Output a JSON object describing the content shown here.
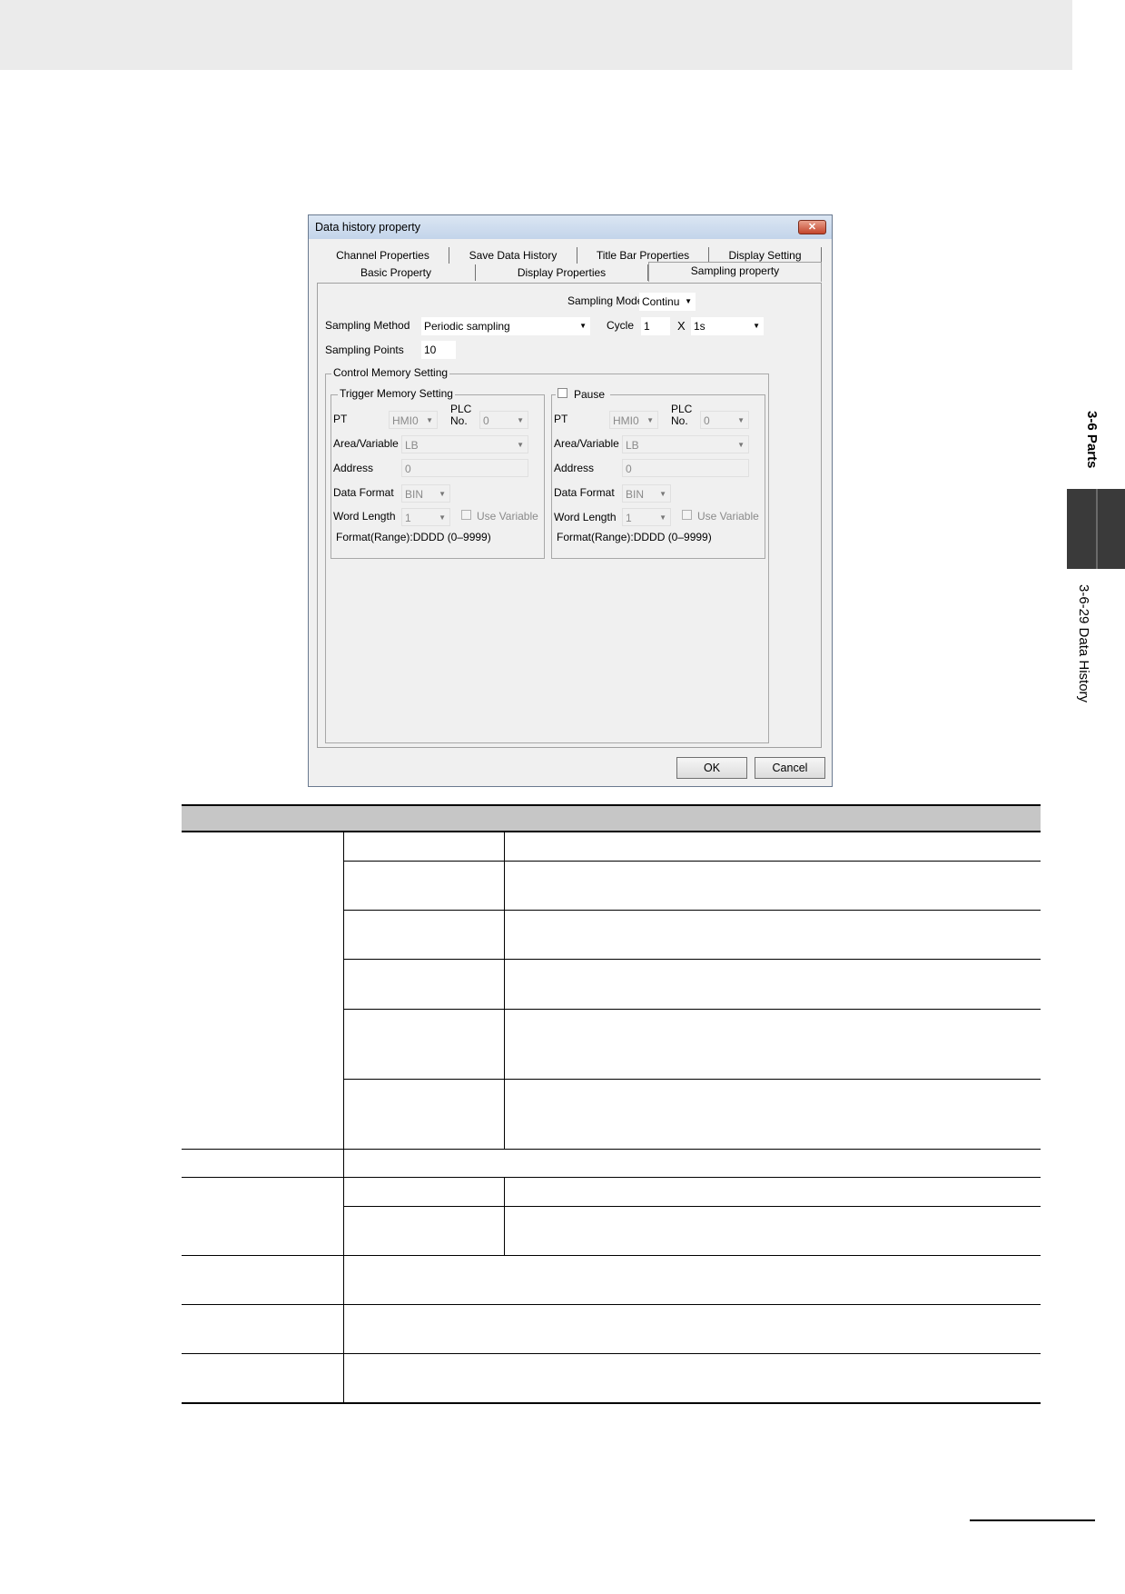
{
  "page": {
    "side_section": "3-6 Parts",
    "side_topic": "3-6-29 Data History"
  },
  "dialog": {
    "title": "Data history property",
    "close_label": "✕",
    "tabs_row1": [
      "Channel Properties",
      "Save Data History",
      "Title Bar Properties",
      "Display Setting"
    ],
    "tabs_row2": [
      "Basic Property",
      "Display Properties",
      "Sampling property"
    ],
    "active_tab": "Sampling property",
    "sampling_mode_label": "Sampling Mode",
    "sampling_mode_value": "Continu",
    "sampling_method_label": "Sampling Method",
    "sampling_method_value": "Periodic sampling",
    "cycle_label": "Cycle",
    "cycle_value": "1",
    "cycle_x": "X",
    "cycle_unit": "1s",
    "sampling_points_label": "Sampling Points",
    "sampling_points_value": "10",
    "control_memory_label": "Control Memory Setting",
    "trigger_group": {
      "title": "Trigger Memory Setting",
      "pt_label": "PT",
      "pt_value": "HMI0",
      "plc_label_1": "PLC",
      "plc_label_2": "No.",
      "plc_value": "0",
      "area_label": "Area/Variable",
      "area_value": "LB",
      "address_label": "Address",
      "address_value": "0",
      "format_label": "Data Format",
      "format_value": "BIN",
      "word_label": "Word Length",
      "word_value": "1",
      "use_variable": "Use Variable",
      "range": "Format(Range):DDDD (0–9999)"
    },
    "pause_group": {
      "title": "Pause",
      "pt_label": "PT",
      "pt_value": "HMI0",
      "plc_label_1": "PLC",
      "plc_label_2": "No.",
      "plc_value": "0",
      "area_label": "Area/Variable",
      "area_value": "LB",
      "address_label": "Address",
      "address_value": "0",
      "format_label": "Data Format",
      "format_value": "BIN",
      "word_label": "Word Length",
      "word_value": "1",
      "use_variable": "Use Variable",
      "range": "Format(Range):DDDD (0–9999)"
    },
    "ok_label": "OK",
    "cancel_label": "Cancel"
  }
}
